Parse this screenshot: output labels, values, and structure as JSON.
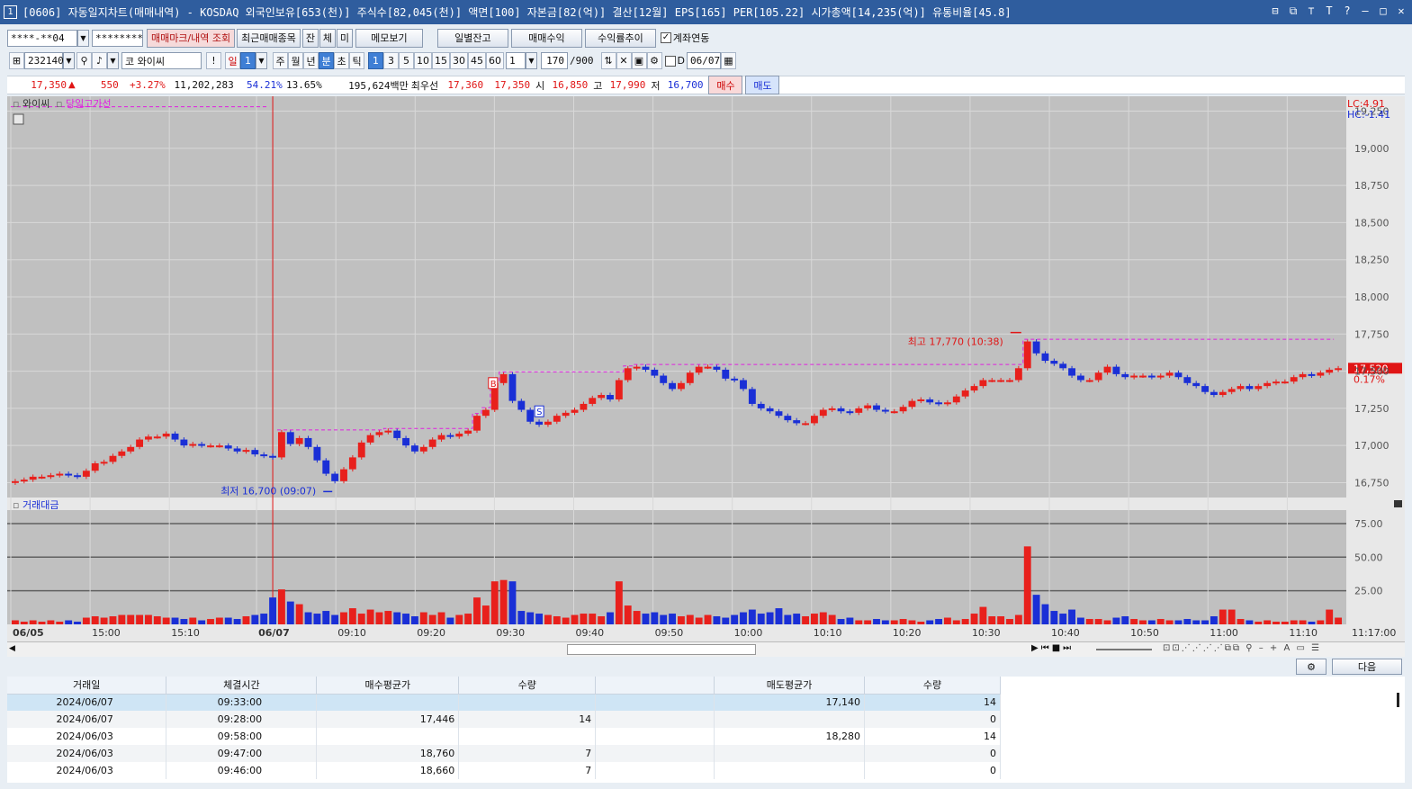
{
  "window": {
    "number": "1",
    "title": "[0606] 자동일지차트(매매내역) - KOSDAQ 외국인보유[653(천)] 주식수[82,045(천)] 액면[100] 자본금[82(억)] 결산[12월] EPS[165] PER[105.22] 시가총액[14,235(억)] 유통비율[45.8]"
  },
  "toolbar1": {
    "account": "****-**04",
    "password": "********",
    "btn_mark": "매매마크/내역 조회",
    "btn_recent": "최근매매종목",
    "btn_jan": "잔",
    "btn_che": "체",
    "btn_mi": "미",
    "btn_memo": "메모보기",
    "btn_daily": "일별잔고",
    "btn_profit": "매매수익",
    "btn_trend": "수익률추이",
    "chk_link": "계좌연동"
  },
  "toolbar2": {
    "code": "232140",
    "market_tag": "코",
    "stock_name": "와이씨",
    "excl": "!",
    "period_day": "일",
    "period_num": "1",
    "periods": [
      "주",
      "월",
      "년",
      "분",
      "초",
      "틱"
    ],
    "minutes": [
      "1",
      "3",
      "5",
      "10",
      "15",
      "30",
      "45",
      "60"
    ],
    "count": "1",
    "view": "170",
    "total": "/900",
    "date_label": "D",
    "date": "06/07"
  },
  "quote": {
    "price": "17,350",
    "up_arrow": "▲",
    "change": "550",
    "rate": "+3.27%",
    "volume": "11,202,283",
    "pct1": "54.21%",
    "pct2": "13.65%",
    "amount": "195,624백만",
    "best_label": "최우선",
    "best_ask": "17,360",
    "best_bid": "17,350",
    "open_label": "시",
    "open": "16,850",
    "high_label": "고",
    "high": "17,990",
    "low_label": "저",
    "low": "16,700",
    "buy": "매수",
    "sell": "매도"
  },
  "chart": {
    "legend_stock": "와이씨",
    "legend_line": "당일고가선",
    "volume_label": "거래대금",
    "lc": "LC:4.91",
    "hc": "HC:-1.41",
    "current_price": "17,520",
    "current_rate": "0.17%",
    "high_note": "최고 17,770 (10:38)",
    "low_note": "최저 16,700 (09:07)",
    "buy_marker": "B",
    "sell_marker": "S",
    "price_ticks": [
      "19,250",
      "19,000",
      "18,750",
      "18,500",
      "18,250",
      "18,000",
      "17,750",
      "17,500",
      "17,250",
      "17,000",
      "16,750"
    ],
    "vol_ticks": [
      "75.00",
      "50.00",
      "25.00"
    ],
    "time_labels": [
      "06/05",
      "15:00",
      "15:10",
      "06/07",
      "09:10",
      "09:20",
      "09:30",
      "09:40",
      "09:50",
      "10:00",
      "10:10",
      "10:20",
      "10:30",
      "10:40",
      "10:50",
      "11:00",
      "11:10",
      "11:17:00"
    ],
    "up_color": "#e8201c",
    "down_color": "#1a2fd6"
  },
  "chart_data": {
    "type": "candlestick",
    "ylim": [
      16650,
      19350
    ],
    "closes": [
      16760,
      16770,
      16790,
      16790,
      16800,
      16810,
      16800,
      16790,
      16830,
      16880,
      16890,
      16930,
      16960,
      16990,
      17040,
      17060,
      17060,
      17080,
      17040,
      17000,
      17010,
      17000,
      17000,
      17000,
      16980,
      16960,
      16970,
      16940,
      16930,
      16920,
      17090,
      17010,
      17050,
      16990,
      16900,
      16810,
      16760,
      16840,
      16920,
      17020,
      17070,
      17090,
      17100,
      17050,
      17000,
      16960,
      16990,
      17040,
      17070,
      17060,
      17080,
      17100,
      17200,
      17240,
      17420,
      17480,
      17300,
      17240,
      17160,
      17140,
      17160,
      17200,
      17220,
      17240,
      17280,
      17320,
      17340,
      17310,
      17440,
      17520,
      17530,
      17510,
      17470,
      17420,
      17380,
      17420,
      17490,
      17530,
      17530,
      17510,
      17450,
      17440,
      17380,
      17280,
      17250,
      17230,
      17200,
      17170,
      17150,
      17150,
      17200,
      17240,
      17250,
      17230,
      17220,
      17250,
      17270,
      17240,
      17230,
      17230,
      17260,
      17300,
      17310,
      17290,
      17280,
      17290,
      17330,
      17370,
      17400,
      17440,
      17440,
      17440,
      17440,
      17520,
      17700,
      17620,
      17570,
      17550,
      17520,
      17470,
      17440,
      17440,
      17490,
      17530,
      17480,
      17460,
      17470,
      17470,
      17460,
      17470,
      17490,
      17460,
      17420,
      17400,
      17360,
      17340,
      17360,
      17380,
      17400,
      17380,
      17400,
      17420,
      17430,
      17430,
      17460,
      17480,
      17470,
      17490,
      17510,
      17520
    ],
    "volumes": [
      3,
      2,
      3,
      2,
      3,
      2,
      3,
      2,
      5,
      6,
      5,
      6,
      7,
      7,
      7,
      7,
      6,
      5,
      5,
      4,
      5,
      3,
      4,
      5,
      5,
      4,
      6,
      7,
      8,
      20,
      26,
      17,
      15,
      9,
      8,
      10,
      7,
      9,
      12,
      8,
      11,
      9,
      10,
      9,
      8,
      6,
      9,
      7,
      9,
      5,
      7,
      8,
      20,
      14,
      32,
      33,
      32,
      10,
      9,
      8,
      7,
      6,
      5,
      7,
      8,
      8,
      6,
      9,
      32,
      14,
      10,
      8,
      9,
      7,
      8,
      6,
      7,
      5,
      7,
      6,
      5,
      7,
      9,
      11,
      8,
      9,
      12,
      7,
      8,
      6,
      8,
      9,
      7,
      4,
      5,
      3,
      3,
      4,
      3,
      3,
      4,
      3,
      2,
      3,
      4,
      5,
      3,
      4,
      8,
      13,
      6,
      6,
      4,
      7,
      58,
      22,
      15,
      10,
      8,
      11,
      5,
      4,
      4,
      3,
      5,
      6,
      4,
      3,
      3,
      4,
      3,
      3,
      4,
      3,
      3,
      6,
      11,
      11,
      4,
      3,
      2,
      3,
      2,
      2,
      3,
      3,
      2,
      3,
      11,
      5
    ]
  },
  "bottom": {
    "settings_icon": "gear",
    "next": "다음",
    "headers": [
      "거래일",
      "체결시간",
      "매수평균가",
      "수량",
      "",
      "매도평균가",
      "수량"
    ],
    "rows": [
      [
        "2024/06/07",
        "09:33:00",
        "",
        "",
        "",
        "17,140",
        "14"
      ],
      [
        "2024/06/07",
        "09:28:00",
        "17,446",
        "14",
        "",
        "",
        "0"
      ],
      [
        "2024/06/03",
        "09:58:00",
        "",
        "",
        "",
        "18,280",
        "14"
      ],
      [
        "2024/06/03",
        "09:47:00",
        "18,760",
        "7",
        "",
        "",
        "0"
      ],
      [
        "2024/06/03",
        "09:46:00",
        "18,660",
        "7",
        "",
        "",
        "0"
      ]
    ]
  }
}
